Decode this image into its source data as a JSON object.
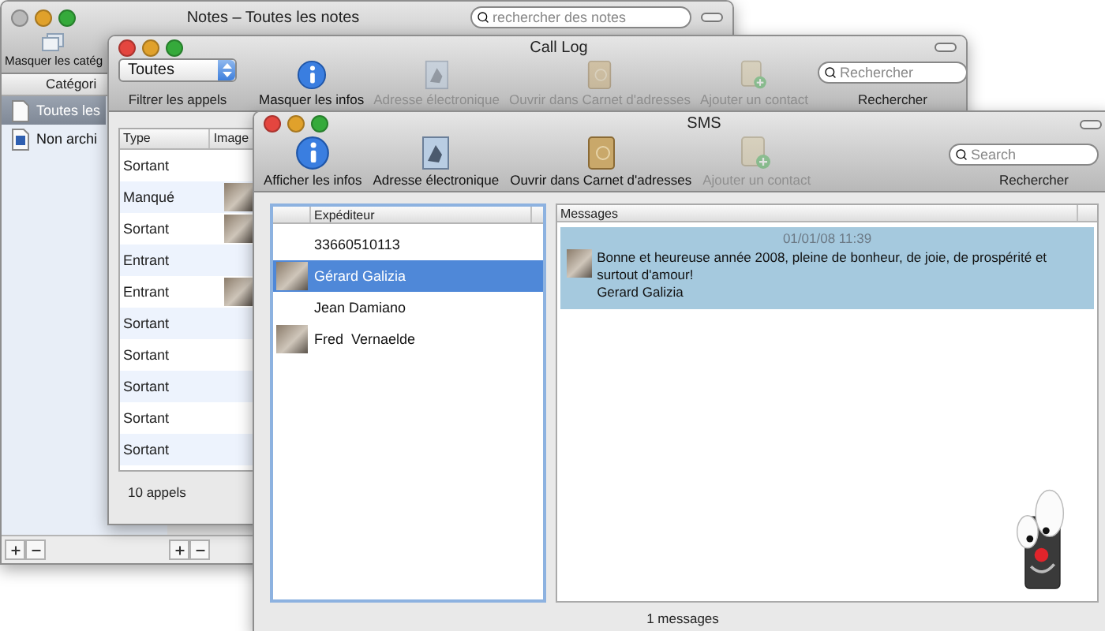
{
  "notes_window": {
    "title": "Notes – Toutes les notes",
    "close_enabled": false,
    "hide_button": "Masquer les catég",
    "search": {
      "placeholder": "rechercher des notes"
    },
    "sidebar": {
      "header": "Catégori",
      "items": [
        {
          "label": "Toutes les",
          "kind": "all",
          "selected": true
        },
        {
          "label": "Non archi",
          "kind": "unfiled",
          "selected": false
        }
      ]
    }
  },
  "call_log_window": {
    "title": "Call Log",
    "close_enabled": true,
    "filter": {
      "value": "Toutes",
      "label": "Filtrer les appels"
    },
    "toolbar": [
      {
        "label": "Masquer les infos",
        "kind": "info",
        "disabled": false
      },
      {
        "label": "Adresse électronique",
        "kind": "email",
        "disabled": true
      },
      {
        "label": "Ouvrir dans Carnet d'adresses",
        "kind": "address_book",
        "disabled": true
      },
      {
        "label": "Ajouter un contact",
        "kind": "add_contact",
        "disabled": true
      }
    ],
    "search": {
      "placeholder": "Rechercher",
      "label": "Rechercher"
    },
    "table": {
      "columns": [
        "Type",
        "Image"
      ],
      "rows": [
        {
          "type": "Sortant",
          "photo": false
        },
        {
          "type": "Manqué",
          "photo": true
        },
        {
          "type": "Sortant",
          "photo": true
        },
        {
          "type": "Entrant",
          "photo": false
        },
        {
          "type": "Entrant",
          "photo": true
        },
        {
          "type": "Sortant",
          "photo": false
        },
        {
          "type": "Sortant",
          "photo": false
        },
        {
          "type": "Sortant",
          "photo": false
        },
        {
          "type": "Sortant",
          "photo": false
        },
        {
          "type": "Sortant",
          "photo": false
        }
      ]
    },
    "status": "10 appels"
  },
  "sms_window": {
    "title": "SMS",
    "close_enabled": true,
    "toolbar": [
      {
        "label": "Afficher les infos",
        "kind": "info",
        "disabled": false
      },
      {
        "label": "Adresse électronique",
        "kind": "email",
        "disabled": false
      },
      {
        "label": "Ouvrir dans Carnet d'adresses",
        "kind": "address_book",
        "disabled": false
      },
      {
        "label": "Ajouter un contact",
        "kind": "add_contact",
        "disabled": true
      }
    ],
    "search": {
      "placeholder": "Search",
      "label": "Rechercher"
    },
    "senders": {
      "column": "Expéditeur",
      "rows": [
        {
          "name": "33660510113",
          "photo": false,
          "selected": false
        },
        {
          "name": "Gérard Galizia",
          "photo": true,
          "selected": true
        },
        {
          "name": "Jean Damiano",
          "photo": false,
          "selected": false
        },
        {
          "name": "Fred  Vernaelde",
          "photo": true,
          "selected": false
        }
      ]
    },
    "messages": {
      "column": "Messages",
      "items": [
        {
          "date": "01/01/08 11:39",
          "text": "Bonne et heureuse année 2008, pleine de bonheur, de joie, de prospérité et surtout d'amour!",
          "sender": "Gerard Galizia",
          "photo": true,
          "selected": true
        }
      ]
    },
    "status": "1 messages"
  }
}
